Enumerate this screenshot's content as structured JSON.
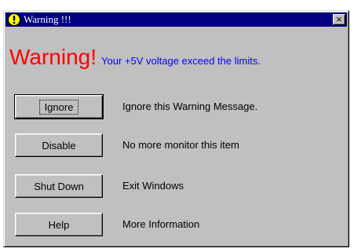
{
  "window": {
    "title": "Warning !!!",
    "title_icon": "warning-exclamation-icon",
    "close_glyph": "×"
  },
  "headline": {
    "big": "Warning!",
    "message": "Your +5V voltage exceed the limits."
  },
  "actions": [
    {
      "label": "Ignore",
      "description": "Ignore this Warning Message."
    },
    {
      "label": "Disable",
      "description": "No more monitor this item"
    },
    {
      "label": "Shut Down",
      "description": "Exit Windows"
    },
    {
      "label": "Help",
      "description": "More Information"
    }
  ],
  "colors": {
    "titlebar": "#000080",
    "face": "#c0c0c0",
    "headline_red": "#ff0000",
    "message_blue": "#0000ff"
  }
}
